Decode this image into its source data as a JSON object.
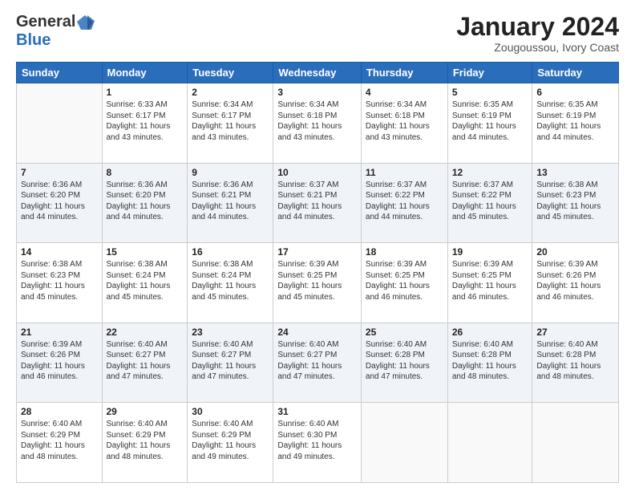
{
  "logo": {
    "general": "General",
    "blue": "Blue"
  },
  "title": "January 2024",
  "location": "Zougoussou, Ivory Coast",
  "days_header": [
    "Sunday",
    "Monday",
    "Tuesday",
    "Wednesday",
    "Thursday",
    "Friday",
    "Saturday"
  ],
  "weeks": [
    [
      {
        "day": "",
        "info": ""
      },
      {
        "day": "1",
        "info": "Sunrise: 6:33 AM\nSunset: 6:17 PM\nDaylight: 11 hours\nand 43 minutes."
      },
      {
        "day": "2",
        "info": "Sunrise: 6:34 AM\nSunset: 6:17 PM\nDaylight: 11 hours\nand 43 minutes."
      },
      {
        "day": "3",
        "info": "Sunrise: 6:34 AM\nSunset: 6:18 PM\nDaylight: 11 hours\nand 43 minutes."
      },
      {
        "day": "4",
        "info": "Sunrise: 6:34 AM\nSunset: 6:18 PM\nDaylight: 11 hours\nand 43 minutes."
      },
      {
        "day": "5",
        "info": "Sunrise: 6:35 AM\nSunset: 6:19 PM\nDaylight: 11 hours\nand 44 minutes."
      },
      {
        "day": "6",
        "info": "Sunrise: 6:35 AM\nSunset: 6:19 PM\nDaylight: 11 hours\nand 44 minutes."
      }
    ],
    [
      {
        "day": "7",
        "info": "Sunrise: 6:36 AM\nSunset: 6:20 PM\nDaylight: 11 hours\nand 44 minutes."
      },
      {
        "day": "8",
        "info": "Sunrise: 6:36 AM\nSunset: 6:20 PM\nDaylight: 11 hours\nand 44 minutes."
      },
      {
        "day": "9",
        "info": "Sunrise: 6:36 AM\nSunset: 6:21 PM\nDaylight: 11 hours\nand 44 minutes."
      },
      {
        "day": "10",
        "info": "Sunrise: 6:37 AM\nSunset: 6:21 PM\nDaylight: 11 hours\nand 44 minutes."
      },
      {
        "day": "11",
        "info": "Sunrise: 6:37 AM\nSunset: 6:22 PM\nDaylight: 11 hours\nand 44 minutes."
      },
      {
        "day": "12",
        "info": "Sunrise: 6:37 AM\nSunset: 6:22 PM\nDaylight: 11 hours\nand 45 minutes."
      },
      {
        "day": "13",
        "info": "Sunrise: 6:38 AM\nSunset: 6:23 PM\nDaylight: 11 hours\nand 45 minutes."
      }
    ],
    [
      {
        "day": "14",
        "info": "Sunrise: 6:38 AM\nSunset: 6:23 PM\nDaylight: 11 hours\nand 45 minutes."
      },
      {
        "day": "15",
        "info": "Sunrise: 6:38 AM\nSunset: 6:24 PM\nDaylight: 11 hours\nand 45 minutes."
      },
      {
        "day": "16",
        "info": "Sunrise: 6:38 AM\nSunset: 6:24 PM\nDaylight: 11 hours\nand 45 minutes."
      },
      {
        "day": "17",
        "info": "Sunrise: 6:39 AM\nSunset: 6:25 PM\nDaylight: 11 hours\nand 45 minutes."
      },
      {
        "day": "18",
        "info": "Sunrise: 6:39 AM\nSunset: 6:25 PM\nDaylight: 11 hours\nand 46 minutes."
      },
      {
        "day": "19",
        "info": "Sunrise: 6:39 AM\nSunset: 6:25 PM\nDaylight: 11 hours\nand 46 minutes."
      },
      {
        "day": "20",
        "info": "Sunrise: 6:39 AM\nSunset: 6:26 PM\nDaylight: 11 hours\nand 46 minutes."
      }
    ],
    [
      {
        "day": "21",
        "info": "Sunrise: 6:39 AM\nSunset: 6:26 PM\nDaylight: 11 hours\nand 46 minutes."
      },
      {
        "day": "22",
        "info": "Sunrise: 6:40 AM\nSunset: 6:27 PM\nDaylight: 11 hours\nand 47 minutes."
      },
      {
        "day": "23",
        "info": "Sunrise: 6:40 AM\nSunset: 6:27 PM\nDaylight: 11 hours\nand 47 minutes."
      },
      {
        "day": "24",
        "info": "Sunrise: 6:40 AM\nSunset: 6:27 PM\nDaylight: 11 hours\nand 47 minutes."
      },
      {
        "day": "25",
        "info": "Sunrise: 6:40 AM\nSunset: 6:28 PM\nDaylight: 11 hours\nand 47 minutes."
      },
      {
        "day": "26",
        "info": "Sunrise: 6:40 AM\nSunset: 6:28 PM\nDaylight: 11 hours\nand 48 minutes."
      },
      {
        "day": "27",
        "info": "Sunrise: 6:40 AM\nSunset: 6:28 PM\nDaylight: 11 hours\nand 48 minutes."
      }
    ],
    [
      {
        "day": "28",
        "info": "Sunrise: 6:40 AM\nSunset: 6:29 PM\nDaylight: 11 hours\nand 48 minutes."
      },
      {
        "day": "29",
        "info": "Sunrise: 6:40 AM\nSunset: 6:29 PM\nDaylight: 11 hours\nand 48 minutes."
      },
      {
        "day": "30",
        "info": "Sunrise: 6:40 AM\nSunset: 6:29 PM\nDaylight: 11 hours\nand 49 minutes."
      },
      {
        "day": "31",
        "info": "Sunrise: 6:40 AM\nSunset: 6:30 PM\nDaylight: 11 hours\nand 49 minutes."
      },
      {
        "day": "",
        "info": ""
      },
      {
        "day": "",
        "info": ""
      },
      {
        "day": "",
        "info": ""
      }
    ]
  ]
}
